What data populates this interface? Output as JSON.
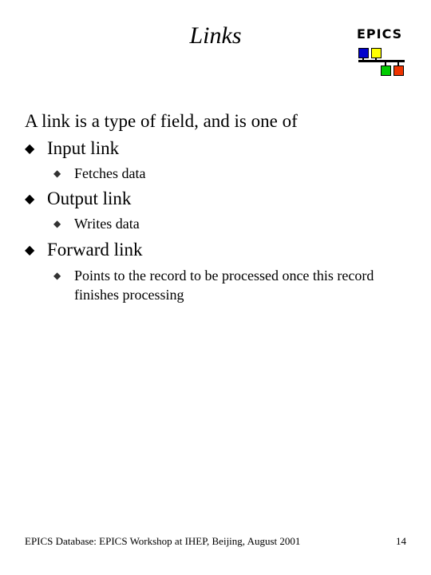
{
  "slide": {
    "title": "Links",
    "logo": {
      "text": "EPICS",
      "colors": {
        "blue": "#0000cc",
        "yellow": "#ffff00",
        "green": "#00cc00",
        "red": "#ee3300"
      }
    },
    "lead": "A link is a type of field, and is one of",
    "bullets": [
      {
        "label": "Input link",
        "sub": "Fetches data"
      },
      {
        "label": "Output link",
        "sub": "Writes data"
      },
      {
        "label": "Forward link",
        "sub": "Points to the record to be processed once this record finishes processing"
      }
    ],
    "bullet_glyph": "◆",
    "footer": "EPICS Database: EPICS Workshop at IHEP, Beijing, August 2001",
    "page_number": "14"
  }
}
